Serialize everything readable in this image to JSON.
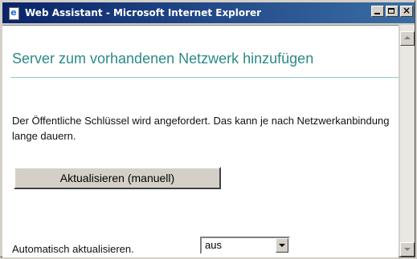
{
  "window": {
    "title": "Web Assistant - Microsoft Internet Explorer",
    "icon": "ie-icon"
  },
  "page": {
    "heading": "Server zum vorhandenen Netzwerk hinzufügen",
    "message": "Der Öffentliche Schlüssel wird angefordert. Das kann je nach Netzwerkanbindung lange dauern.",
    "refresh_button": "Aktualisieren (manuell)",
    "auto_refresh_label": "Automatisch aktualisieren.",
    "auto_refresh_value": "aus"
  },
  "colors": {
    "heading": "#2b8a86",
    "rule": "#8cc9c5",
    "titlebar": "#0a246a"
  }
}
